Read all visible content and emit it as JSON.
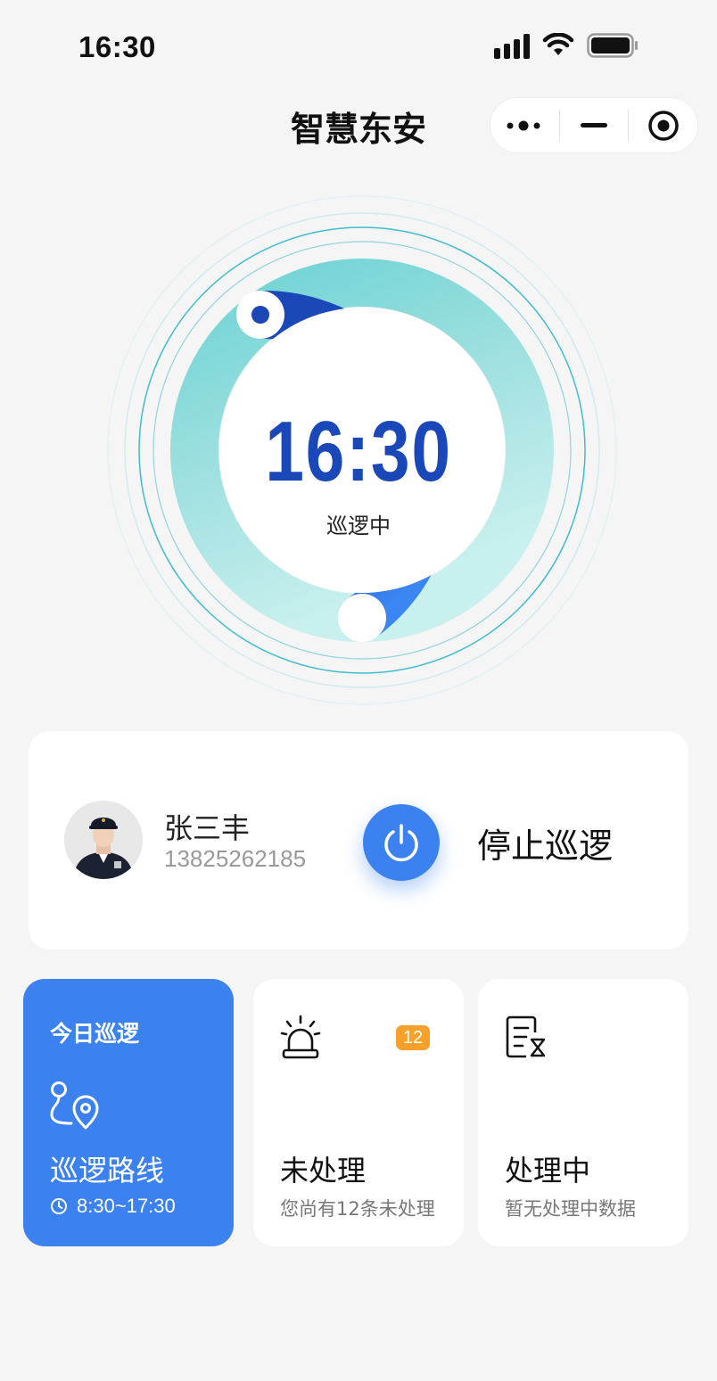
{
  "status_bar": {
    "time": "16:30"
  },
  "header": {
    "title": "智慧东安"
  },
  "dial": {
    "time": "16:30",
    "status": "巡逻中"
  },
  "user": {
    "name": "张三丰",
    "phone": "13825262185",
    "stop_label": "停止巡逻"
  },
  "cards": {
    "today": {
      "kicker": "今日巡逻",
      "title": "巡逻路线",
      "time_range": "8:30~17:30"
    },
    "unprocessed": {
      "title": "未处理",
      "badge": "12",
      "sub": "您尚有12条未处理"
    },
    "processing": {
      "title": "处理中",
      "sub": "暂无处理中数据"
    }
  },
  "colors": {
    "primary": "#3b82f0",
    "dark_blue": "#1b48b8",
    "teal": "#a6e3e2",
    "badge": "#f7a12b"
  }
}
